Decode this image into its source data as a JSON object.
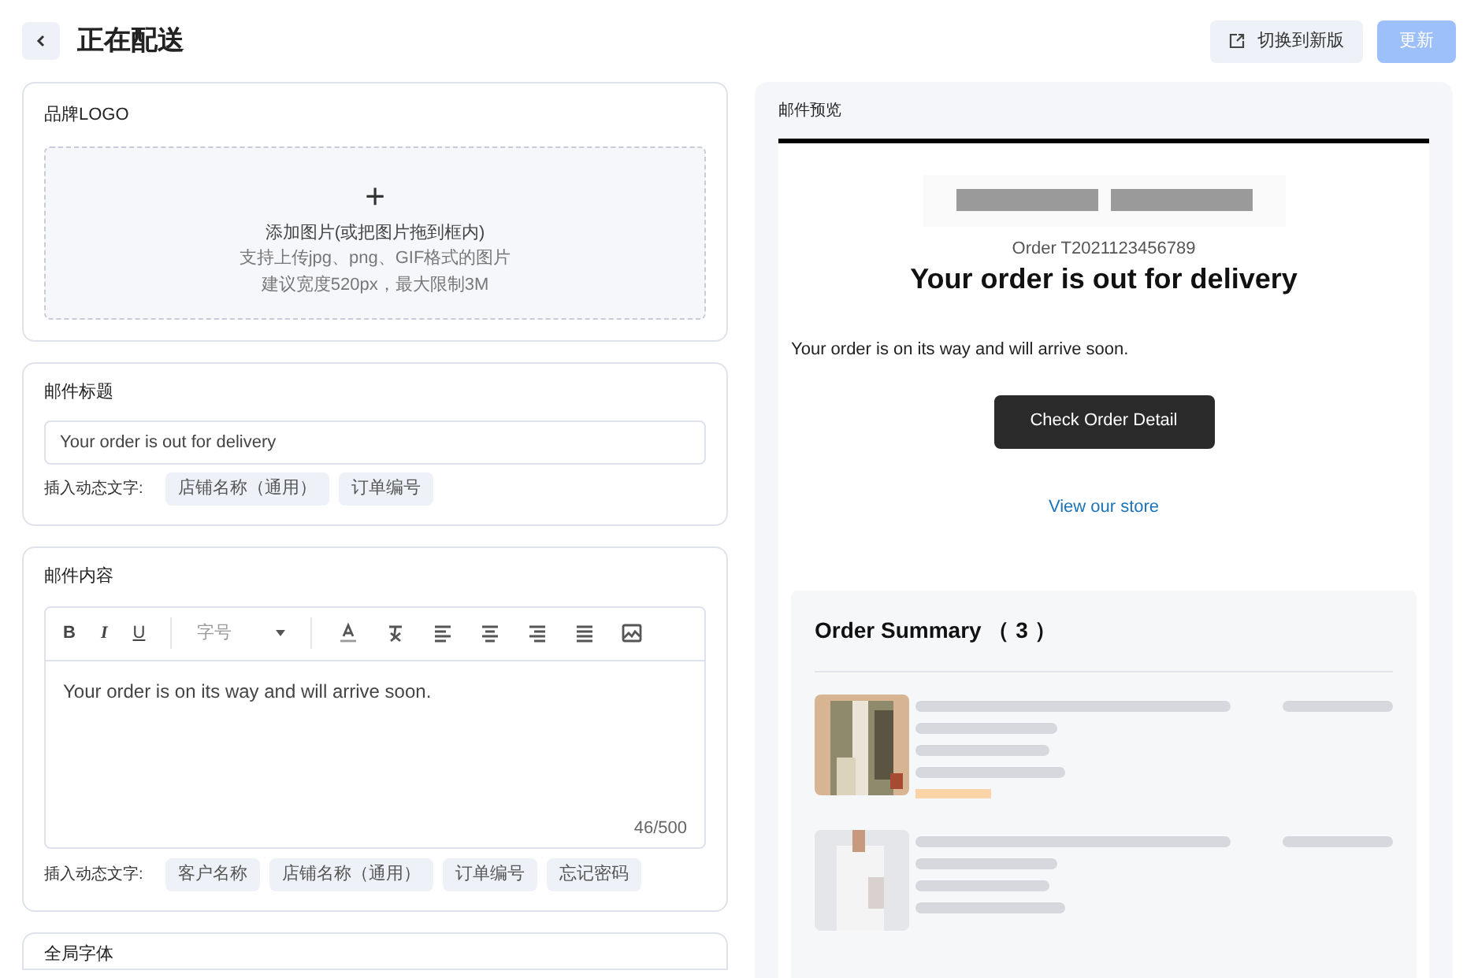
{
  "header": {
    "title": "正在配送",
    "switch_button": "切换到新版",
    "update_button": {
      "label": "更新",
      "disabled": true
    }
  },
  "logo_card": {
    "title": "品牌LOGO",
    "upload": {
      "icon": "+",
      "label": "添加图片(或把图片拖到框内)",
      "hint_1": "支持上传jpg、png、GIF格式的图片",
      "hint_2": "建议宽度520px，最大限制3M"
    }
  },
  "subject_card": {
    "title": "邮件标题",
    "value": "Your order is out for delivery",
    "insert_label": "插入动态文字:",
    "tags": [
      "店铺名称（通用）",
      "订单编号"
    ]
  },
  "content_card": {
    "title": "邮件内容",
    "toolbar": {
      "bold": "B",
      "italic": "I",
      "underline": "U",
      "font_size": "字号"
    },
    "body": "Your order is on its way and will arrive soon.",
    "counter": "46/500",
    "insert_label": "插入动态文字:",
    "tags": [
      "客户名称",
      "店铺名称（通用）",
      "订单编号",
      "忘记密码"
    ]
  },
  "font_card": {
    "title": "全局字体"
  },
  "preview": {
    "title": "邮件预览",
    "order_number": "Order T2021123456789",
    "heading": "Your order is out for delivery",
    "body": "Your order is on its way and will arrive soon.",
    "button": "Check Order Detail",
    "link": "View our store",
    "summary": {
      "title": "Order Summary （ 3 ）"
    }
  }
}
